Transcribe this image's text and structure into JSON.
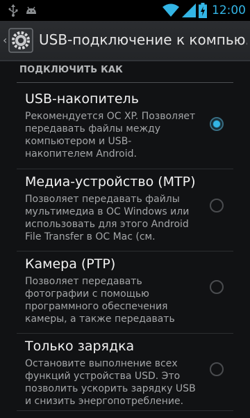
{
  "status_bar": {
    "time": "12:00",
    "icons": [
      "usb-icon",
      "android-debug-icon",
      "wifi-icon",
      "signal-icon",
      "battery-charging-icon"
    ],
    "accent_color": "#33b5e5"
  },
  "action_bar": {
    "title": "USB-подключение к компью...",
    "icon": "usb-settings-icon"
  },
  "section": {
    "header": "ПОДКЛЮЧИТЬ КАК"
  },
  "options": [
    {
      "title": "USB-накопитель",
      "summary": "Рекомендуется ОС XP. Позволяет передавать файлы между компьютером и USB-накопителем Android.",
      "checked": true
    },
    {
      "title": "Медиа-устройство (MTP)",
      "summary": "Позволяет передавать файлы мультимедиа в ОС Windows или использовать для этого Android File Transfer в ОС Mac (см.",
      "checked": false
    },
    {
      "title": "Камера (PTP)",
      "summary": "Позволяет передавать фотографии с помощью программного обеспечения камеры, а также передавать",
      "checked": false
    },
    {
      "title": "Только зарядка",
      "summary": "Остановите выполнение всех функций устройства USD. Это позволить ускорить зарядку USB и снизить энергопотребление.",
      "checked": false
    }
  ]
}
